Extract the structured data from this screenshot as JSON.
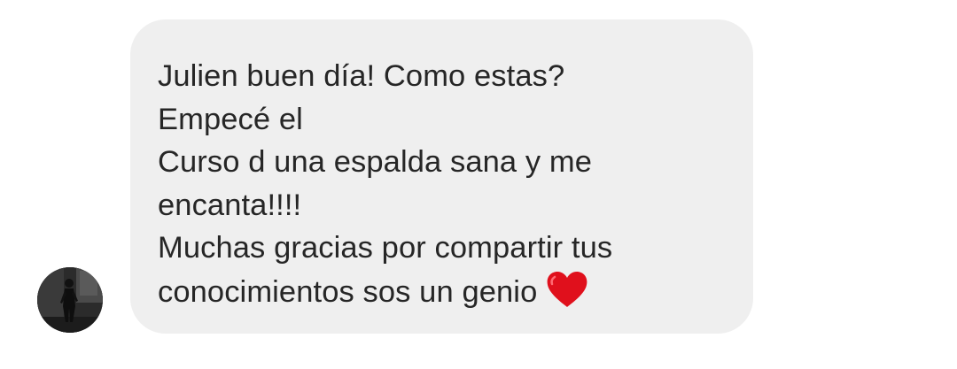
{
  "message": {
    "lines": [
      "Julien buen día! Como estas?",
      "Empecé el",
      "Curso d una espalda sana y me",
      "encanta!!!!",
      "Muchas gracias por compartir tus",
      "conocimientos sos un genio"
    ],
    "emoji": "heart-icon"
  },
  "colors": {
    "bubble_background": "#efefef",
    "text": "#262626",
    "heart": "#e0101c"
  }
}
